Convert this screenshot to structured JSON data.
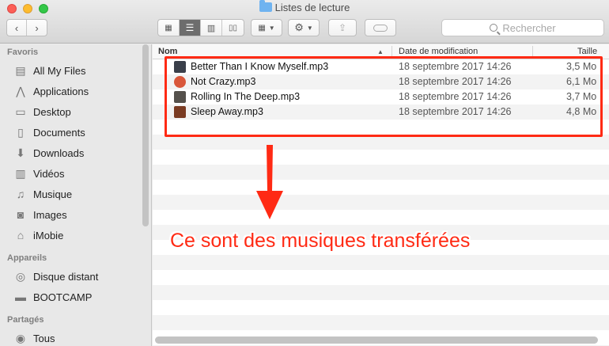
{
  "window": {
    "title": "Listes de lecture"
  },
  "toolbar": {
    "search_placeholder": "Rechercher"
  },
  "sidebar": {
    "sections": [
      {
        "title": "Favoris",
        "items": [
          {
            "label": "All My Files",
            "icon": "all-files-icon"
          },
          {
            "label": "Applications",
            "icon": "applications-icon"
          },
          {
            "label": "Desktop",
            "icon": "desktop-icon"
          },
          {
            "label": "Documents",
            "icon": "documents-icon"
          },
          {
            "label": "Downloads",
            "icon": "downloads-icon"
          },
          {
            "label": "Vidéos",
            "icon": "videos-icon"
          },
          {
            "label": "Musique",
            "icon": "music-icon"
          },
          {
            "label": "Images",
            "icon": "images-icon"
          },
          {
            "label": "iMobie",
            "icon": "home-icon"
          }
        ]
      },
      {
        "title": "Appareils",
        "items": [
          {
            "label": "Disque distant",
            "icon": "disc-icon"
          },
          {
            "label": "BOOTCAMP",
            "icon": "drive-icon"
          }
        ]
      },
      {
        "title": "Partagés",
        "items": [
          {
            "label": "Tous",
            "icon": "network-icon"
          }
        ]
      }
    ]
  },
  "columns": {
    "name": "Nom",
    "date": "Date de modification",
    "size": "Taille"
  },
  "files": [
    {
      "name": "Better Than I Know Myself.mp3",
      "date": "18 septembre 2017 14:26",
      "size": "3,5 Mo",
      "thumb_color": "#3a3f4a"
    },
    {
      "name": "Not Crazy.mp3",
      "date": "18 septembre 2017 14:26",
      "size": "6,1 Mo",
      "thumb_color": "#d9573a"
    },
    {
      "name": "Rolling In The Deep.mp3",
      "date": "18 septembre 2017 14:26",
      "size": "3,7 Mo",
      "thumb_color": "#55514c"
    },
    {
      "name": "Sleep Away.mp3",
      "date": "18 septembre 2017 14:26",
      "size": "4,8 Mo",
      "thumb_color": "#7a3b22"
    }
  ],
  "annotation": {
    "text": "Ce sont des musiques transférées",
    "color": "#ff2a14"
  }
}
